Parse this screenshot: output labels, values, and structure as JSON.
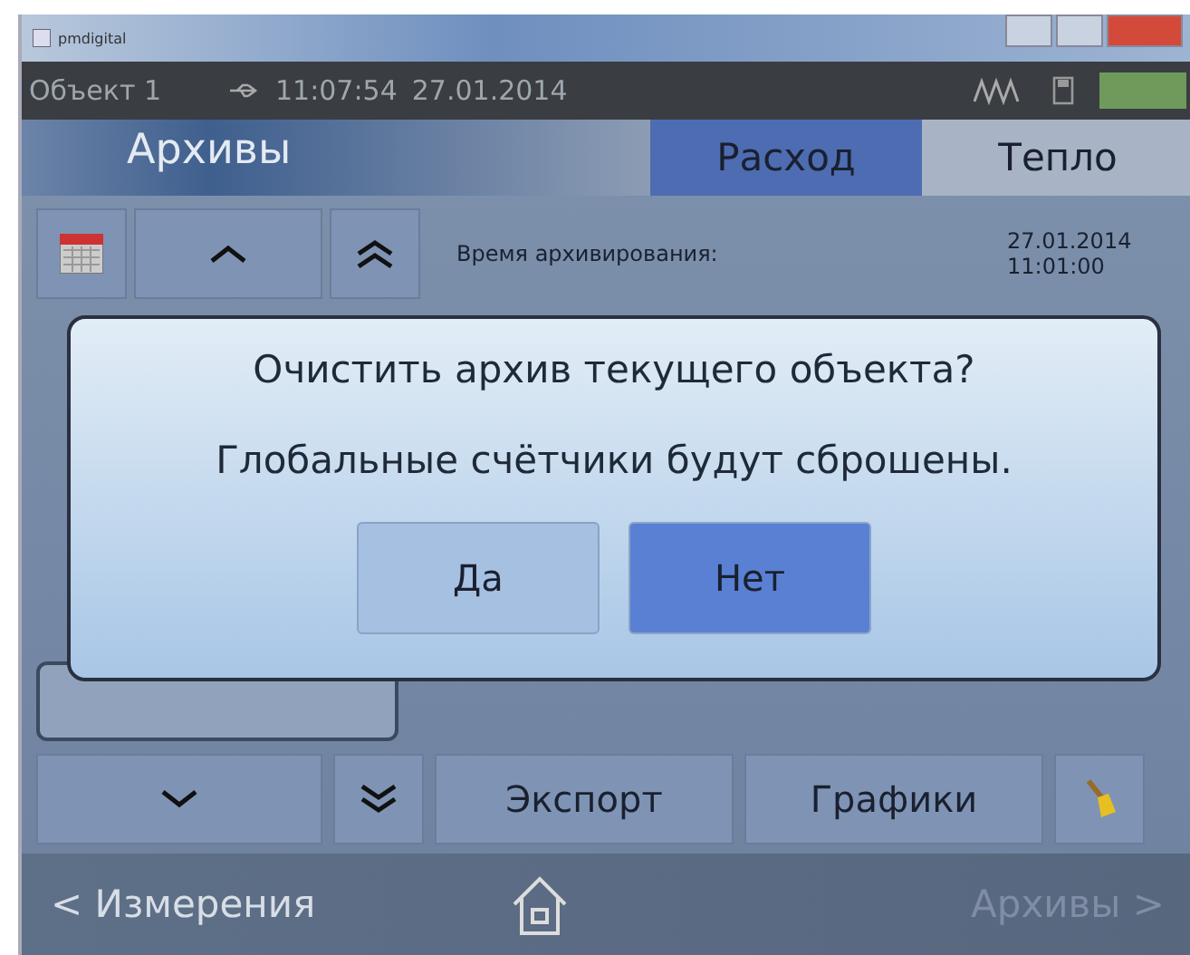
{
  "window": {
    "title": "pmdigital"
  },
  "status_bar": {
    "object": "Объект 1",
    "time": "11:07:54",
    "date": "27.01.2014"
  },
  "header": {
    "title": "Архивы"
  },
  "tabs": [
    {
      "label": "Расход",
      "selected": true
    },
    {
      "label": "Тепло",
      "selected": false
    }
  ],
  "record": {
    "label": "Время архивирования:",
    "value_date": "27.01.2014",
    "value_time": "11:01:00"
  },
  "dialog": {
    "question": "Очистить архив текущего объекта?",
    "message": "Глобальные счётчики будут сброшены.",
    "buttons": [
      {
        "label": "Да",
        "selected": false
      },
      {
        "label": "Нет",
        "selected": true
      }
    ]
  },
  "actions": [
    {
      "label": "Экспорт"
    },
    {
      "label": "Графики"
    }
  ],
  "nav": {
    "back": {
      "label": "< Измерения",
      "disabled": false
    },
    "forward": {
      "label": "Архивы >",
      "disabled": true
    }
  }
}
